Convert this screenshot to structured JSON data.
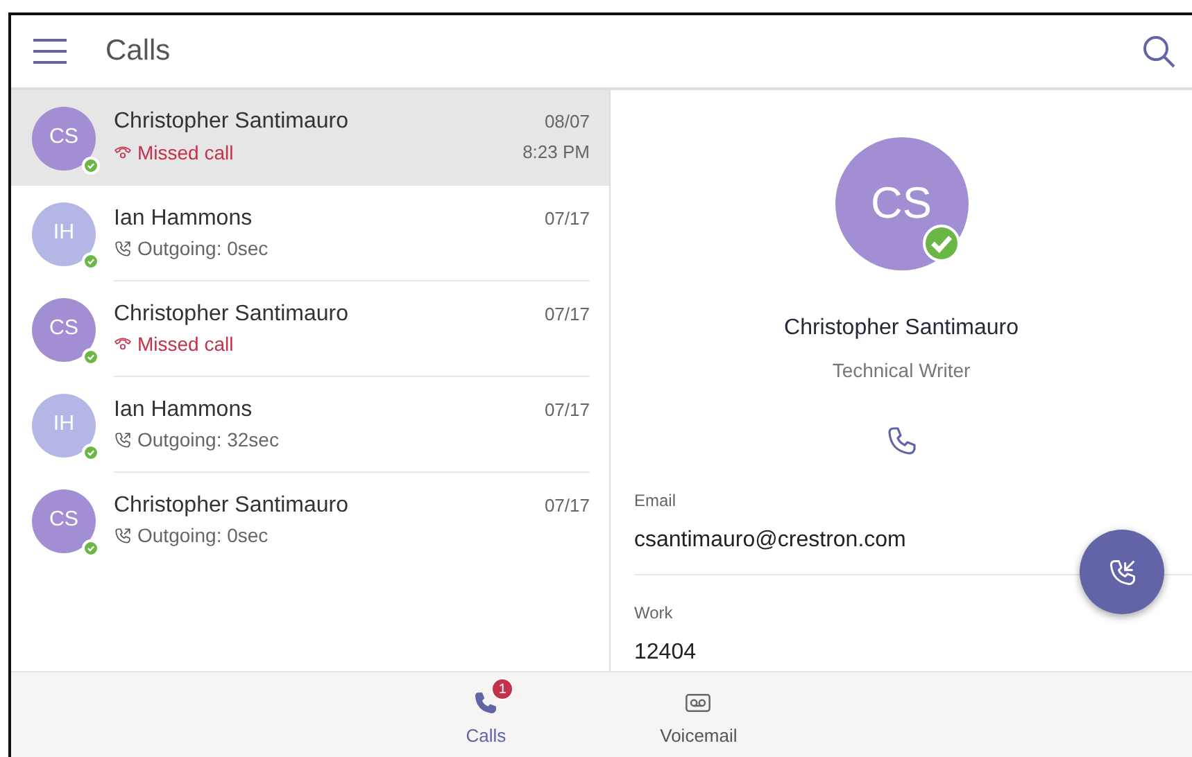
{
  "header": {
    "title": "Calls"
  },
  "calls": [
    {
      "initials": "CS",
      "name": "Christopher Santimauro",
      "kind": "missed",
      "detail": "Missed call",
      "date": "08/07",
      "time": "8:23 PM",
      "selected": true,
      "color": "#a18ed3"
    },
    {
      "initials": "IH",
      "name": "Ian Hammons",
      "kind": "outgoing",
      "detail": "Outgoing: 0sec",
      "date": "07/17",
      "selected": false,
      "color": "#b4b6e6"
    },
    {
      "initials": "CS",
      "name": "Christopher Santimauro",
      "kind": "missed",
      "detail": "Missed call",
      "date": "07/17",
      "selected": false,
      "color": "#a18ed3"
    },
    {
      "initials": "IH",
      "name": "Ian Hammons",
      "kind": "outgoing",
      "detail": "Outgoing: 32sec",
      "date": "07/17",
      "selected": false,
      "color": "#b4b6e6"
    },
    {
      "initials": "CS",
      "name": "Christopher Santimauro",
      "kind": "outgoing",
      "detail": "Outgoing: 0sec",
      "date": "07/17",
      "selected": false,
      "color": "#a18ed3"
    }
  ],
  "contact": {
    "initials": "CS",
    "name": "Christopher Santimauro",
    "title": "Technical Writer",
    "color": "#a18ed3",
    "fields": [
      {
        "label": "Email",
        "value": "csantimauro@crestron.com"
      },
      {
        "label": "Work",
        "value": "12404"
      }
    ]
  },
  "tabs": [
    {
      "label": "Calls",
      "badge": "1",
      "selected": true
    },
    {
      "label": "Voicemail",
      "selected": false
    }
  ]
}
